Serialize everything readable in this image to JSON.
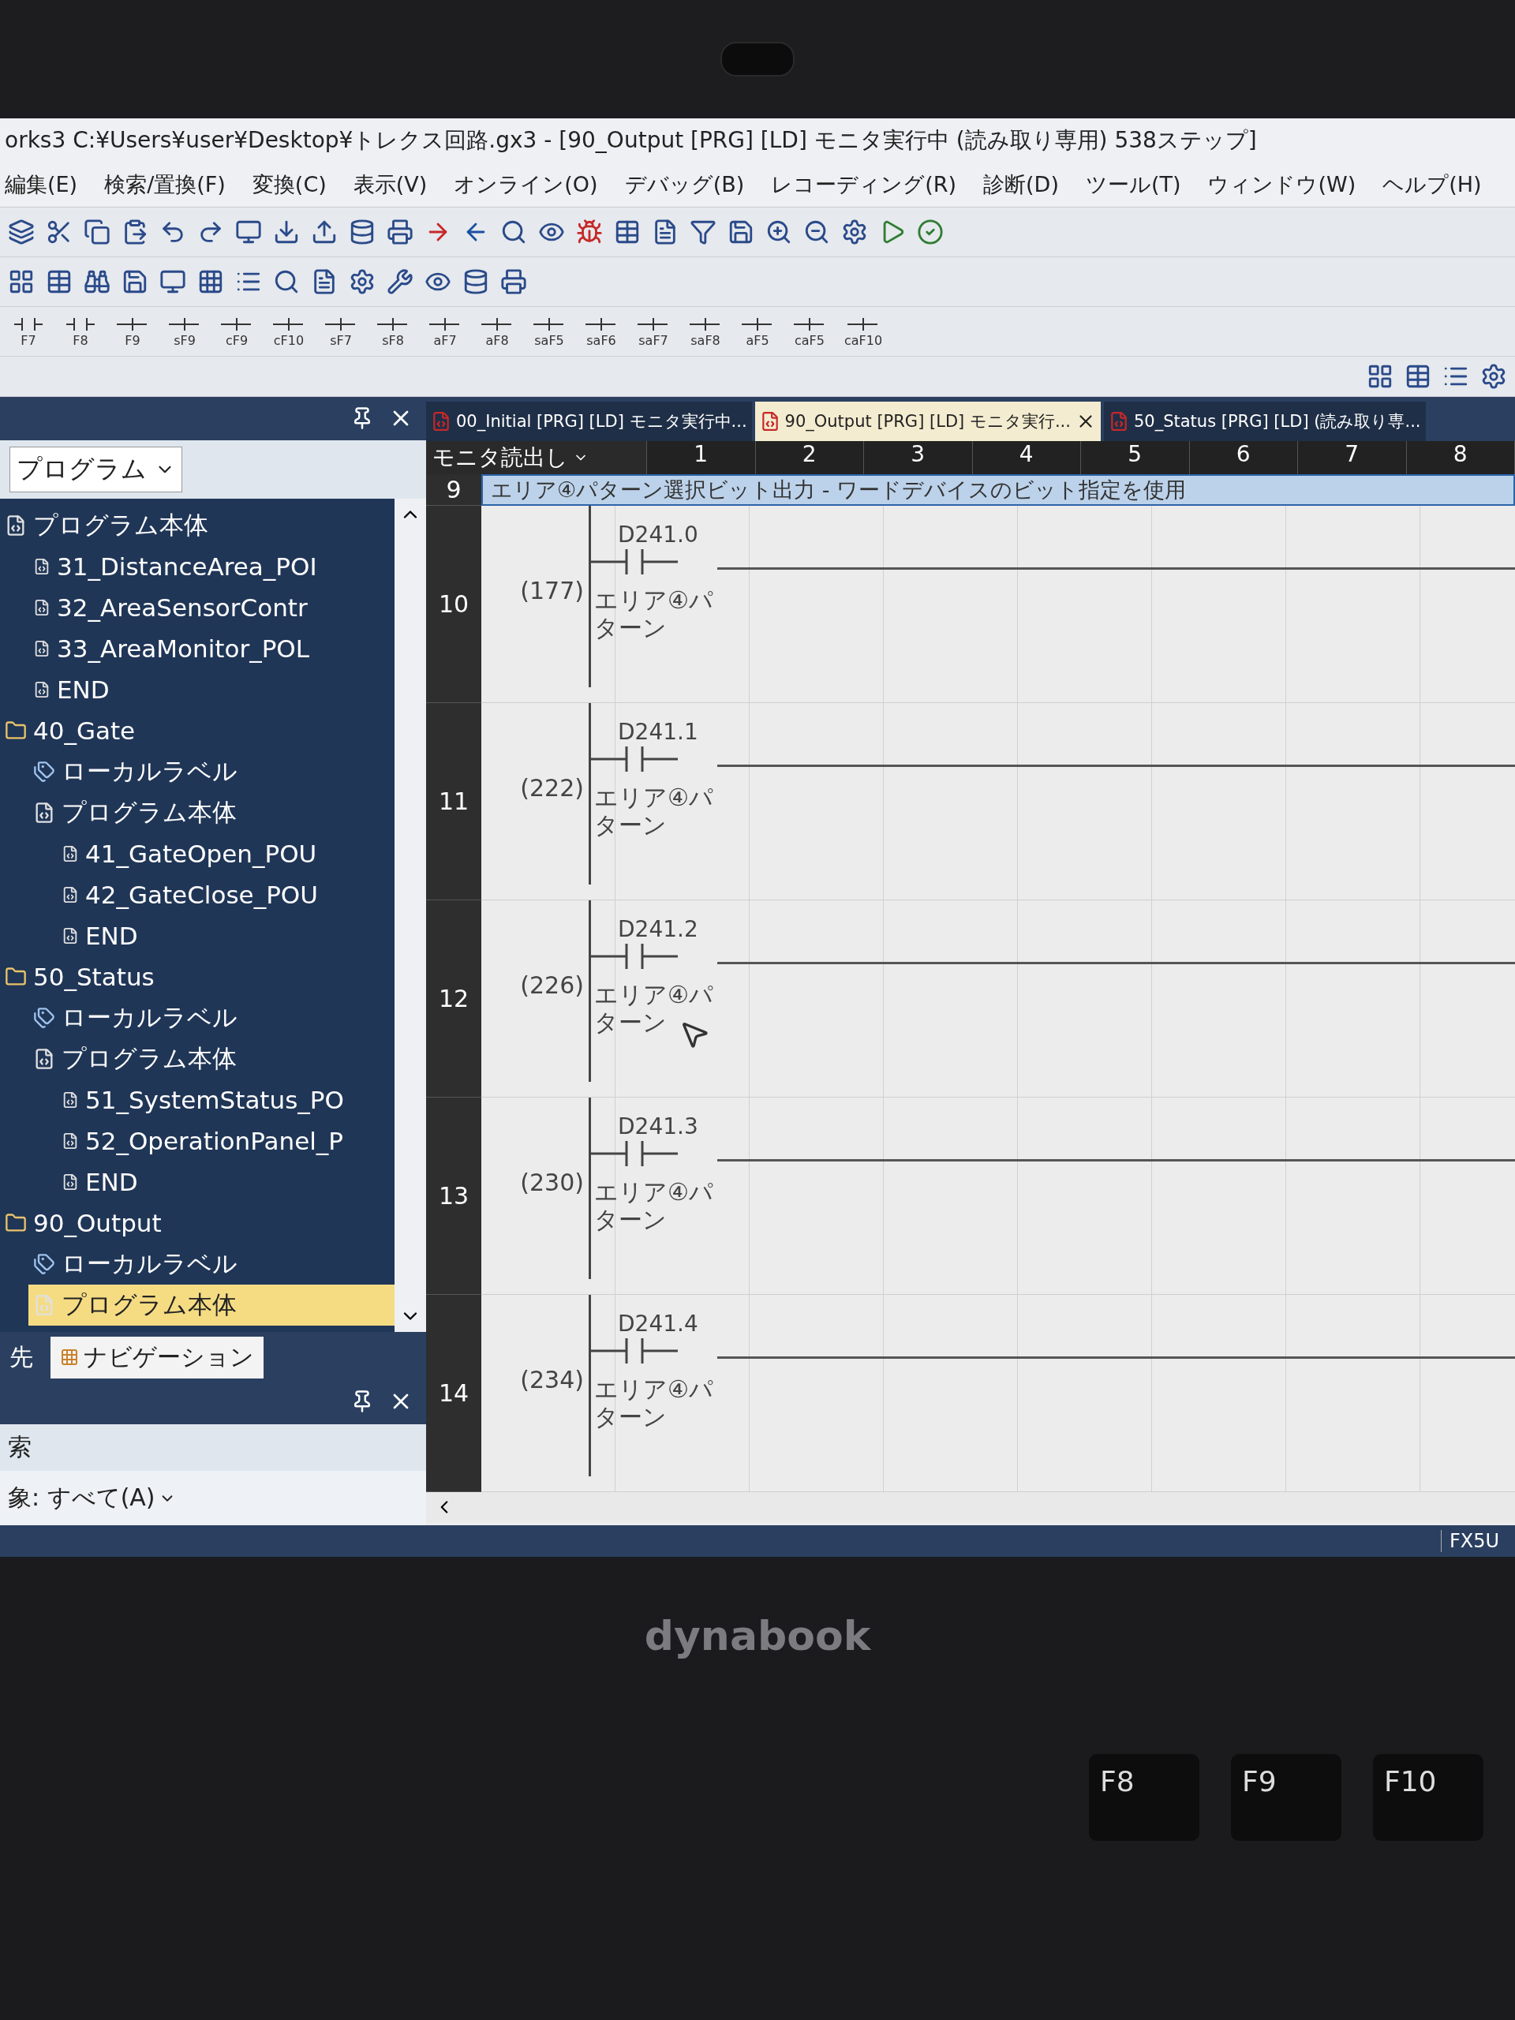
{
  "window": {
    "title": "orks3 C:¥Users¥user¥Desktop¥トレクス回路.gx3 - [90_Output [PRG] [LD] モニタ実行中 (読み取り専用) 538ステップ]"
  },
  "menu": [
    "編集(E)",
    "検索/置換(F)",
    "変換(C)",
    "表示(V)",
    "オンライン(O)",
    "デバッグ(B)",
    "レコーディング(R)",
    "診断(D)",
    "ツール(T)",
    "ウィンドウ(W)",
    "ヘルプ(H)"
  ],
  "function_keys": [
    "F7",
    "F8",
    "F9",
    "sF9",
    "cF9",
    "cF10",
    "sF7",
    "sF8",
    "aF7",
    "aF8",
    "saF5",
    "saF6",
    "saF7",
    "saF8",
    "aF5",
    "caF5",
    "caF10"
  ],
  "tabs": [
    {
      "label": "00_Initial [PRG] [LD] モニタ実行中...",
      "selected": false
    },
    {
      "label": "90_Output [PRG] [LD] モニタ実行...",
      "selected": true
    },
    {
      "label": "50_Status [PRG] [LD] (読み取り専...",
      "selected": false
    }
  ],
  "navigator": {
    "view": "プログラム",
    "tree": [
      {
        "label": "プログラム本体",
        "kind": "program",
        "selected": false,
        "children": [
          {
            "label": "31_DistanceArea_POI",
            "kind": "pou",
            "selected": false
          },
          {
            "label": "32_AreaSensorContr",
            "kind": "pou",
            "selected": false
          },
          {
            "label": "33_AreaMonitor_POL",
            "kind": "pou",
            "selected": false
          },
          {
            "label": "END",
            "kind": "pou",
            "selected": false
          }
        ]
      },
      {
        "label": "40_Gate",
        "kind": "task",
        "selected": false,
        "children": [
          {
            "label": "ローカルラベル",
            "kind": "labels",
            "selected": false
          },
          {
            "label": "プログラム本体",
            "kind": "program",
            "selected": false,
            "children": [
              {
                "label": "41_GateOpen_POU",
                "kind": "pou",
                "selected": false
              },
              {
                "label": "42_GateClose_POU",
                "kind": "pou",
                "selected": false
              },
              {
                "label": "END",
                "kind": "pou",
                "selected": false
              }
            ]
          }
        ]
      },
      {
        "label": "50_Status",
        "kind": "task",
        "selected": false,
        "children": [
          {
            "label": "ローカルラベル",
            "kind": "labels",
            "selected": false
          },
          {
            "label": "プログラム本体",
            "kind": "program",
            "selected": false,
            "children": [
              {
                "label": "51_SystemStatus_PO",
                "kind": "pou",
                "selected": false
              },
              {
                "label": "52_OperationPanel_P",
                "kind": "pou",
                "selected": false
              },
              {
                "label": "END",
                "kind": "pou",
                "selected": false
              }
            ]
          }
        ]
      },
      {
        "label": "90_Output",
        "kind": "task",
        "selected": false,
        "children": [
          {
            "label": "ローカルラベル",
            "kind": "labels",
            "selected": false
          },
          {
            "label": "プログラム本体",
            "kind": "program",
            "selected": true
          }
        ]
      }
    ],
    "bottom_tabs": [
      {
        "label": "先",
        "selected": false
      },
      {
        "label": "ナビゲーション",
        "selected": true
      }
    ],
    "search_title": "索",
    "search_scope": "象: すべて(A)"
  },
  "ladder": {
    "mode": "モニタ読出し",
    "columns": [
      "1",
      "2",
      "3",
      "4",
      "5",
      "6",
      "7",
      "8"
    ],
    "comment_row": {
      "number": "9",
      "text": "エリア④パターン選択ビット出力 - ワードデバイスのビット指定を使用"
    },
    "rungs": [
      {
        "number": "10",
        "step": "(177)",
        "device": "D241.0",
        "comment": "エリア④パターン",
        "cursor": false
      },
      {
        "number": "11",
        "step": "(222)",
        "device": "D241.1",
        "comment": "エリア④パターン",
        "cursor": false
      },
      {
        "number": "12",
        "step": "(226)",
        "device": "D241.2",
        "comment": "エリア④パターン",
        "cursor": true
      },
      {
        "number": "13",
        "step": "(230)",
        "device": "D241.3",
        "comment": "エリア④パターン",
        "cursor": false
      },
      {
        "number": "14",
        "step": "(234)",
        "device": "D241.4",
        "comment": "エリア④パターン",
        "cursor": false
      }
    ]
  },
  "status_bar": {
    "cpu": "FX5U"
  },
  "laptop": {
    "logo": "dynabook",
    "keys": [
      "F8",
      "F9",
      "F10"
    ]
  }
}
